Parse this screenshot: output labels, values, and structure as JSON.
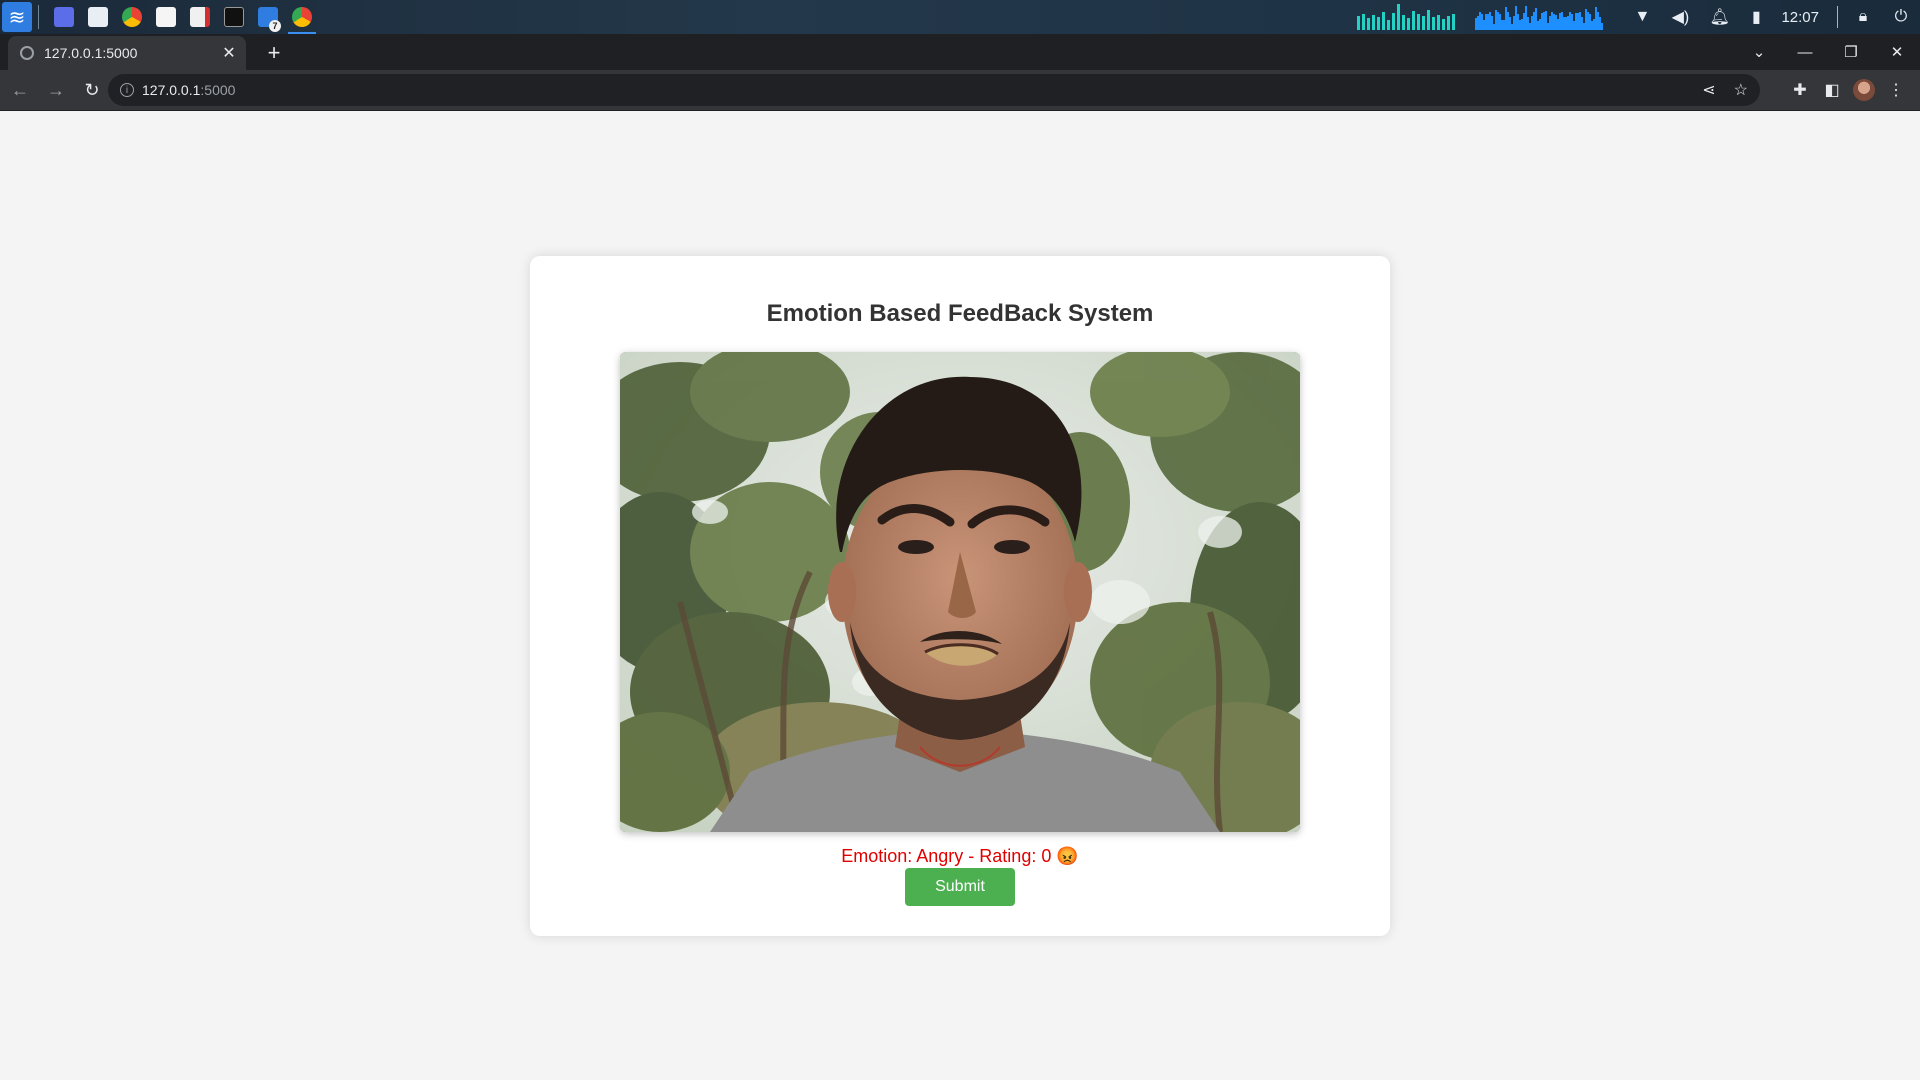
{
  "taskbar": {
    "apps": [
      "launcher",
      "desktop",
      "files",
      "chrome",
      "document-viewer",
      "pdf-editor",
      "terminal",
      "file-manager",
      "chrome-active"
    ],
    "file_manager_badge": "7",
    "clock": "12:07"
  },
  "browser": {
    "tab_title": "127.0.0.1:5000",
    "url_host": "127.0.0.1",
    "url_port": ":5000"
  },
  "page": {
    "title": "Emotion Based FeedBack System",
    "emotion_text": "Emotion: Angry - Rating: 0 😡",
    "submit_label": "Submit"
  },
  "colors": {
    "emotion_text": "#e00000",
    "submit_button": "#4caf50",
    "page_background": "#f4f4f4"
  }
}
